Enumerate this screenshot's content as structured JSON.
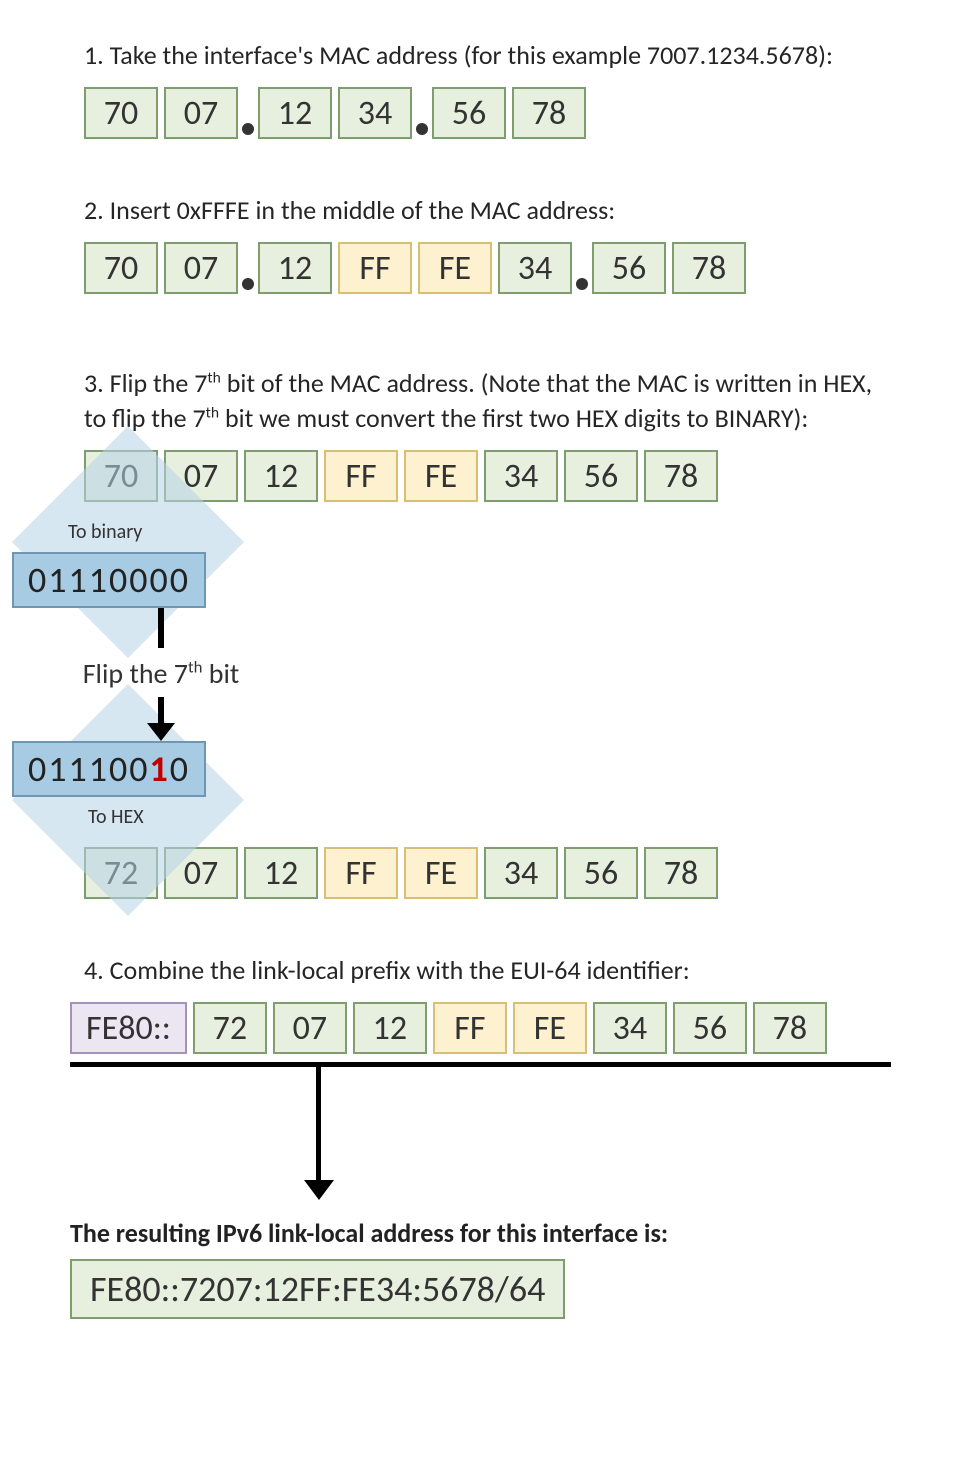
{
  "step1": {
    "text": "1. Take the interface's MAC address (for this example 7007.1234.5678):",
    "bytes": [
      "70",
      "07",
      "12",
      "34",
      "56",
      "78"
    ]
  },
  "step2": {
    "text": "2. Insert 0xFFFE in the middle of the MAC address:",
    "bytes": [
      "70",
      "07",
      "12",
      "FF",
      "FE",
      "34",
      "56",
      "78"
    ]
  },
  "step3": {
    "text_pre": "3. Flip the 7",
    "text_mid1": " bit of the MAC address. (Note that the MAC is written in HEX, to flip the 7",
    "text_post": " bit we must convert the first two HEX digits to BINARY):",
    "bytes_before": [
      "70",
      "07",
      "12",
      "FF",
      "FE",
      "34",
      "56",
      "78"
    ],
    "to_binary_label": "To binary",
    "bin_before": "01110000",
    "flip_label_pre": "Flip the 7",
    "flip_label_post": " bit",
    "bin_after_prefix": "011100",
    "bin_after_flipped": "1",
    "bin_after_suffix": "0",
    "to_hex_label": "To HEX",
    "bytes_after": [
      "72",
      "07",
      "12",
      "FF",
      "FE",
      "34",
      "56",
      "78"
    ]
  },
  "step4": {
    "text": "4. Combine the link-local prefix with the EUI-64 identifier:",
    "prefix": "FE80::",
    "bytes": [
      "72",
      "07",
      "12",
      "FF",
      "FE",
      "34",
      "56",
      "78"
    ]
  },
  "result": {
    "title": "The resulting IPv6 link-local address for this interface is:",
    "address": "FE80::7207:12FF:FE34:5678/64"
  }
}
